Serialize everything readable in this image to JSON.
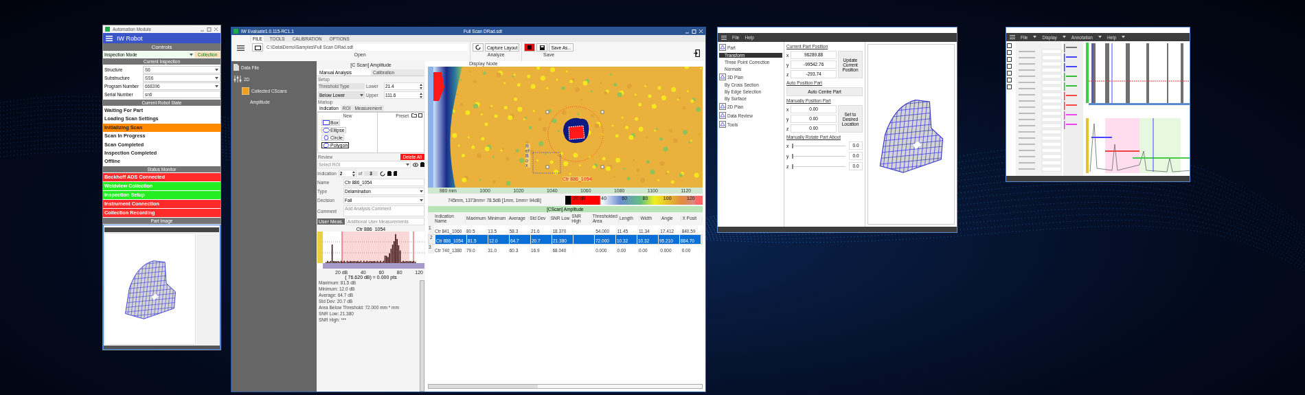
{
  "automation_window": {
    "title": "Automation Module",
    "app_title": "IW Robot",
    "controls_header": "Controls",
    "mode_label": "Inspection Mode",
    "mode_button": "Collection",
    "inspection_header": "Current Inspection",
    "fields": [
      {
        "label": "Structure",
        "value": "S6",
        "kind": "select"
      },
      {
        "label": "Substructure",
        "value": "SS6",
        "kind": "select"
      },
      {
        "label": "Program Number",
        "value": "668396",
        "kind": "select"
      },
      {
        "label": "Serial Number",
        "value": "sn6",
        "kind": "text"
      }
    ],
    "state_header": "Current Robot State",
    "states": [
      {
        "label": "Waiting For Part",
        "selected": false
      },
      {
        "label": "Loading Scan Settings",
        "selected": false
      },
      {
        "label": "Initializing Scan",
        "selected": true
      },
      {
        "label": "Scan In Progress",
        "selected": false
      },
      {
        "label": "Scan Completed",
        "selected": false
      },
      {
        "label": "Inspection Completed",
        "selected": false
      },
      {
        "label": "Offline",
        "selected": false
      }
    ],
    "status_header": "Status Monitor",
    "statuses": [
      {
        "label": "Beckhoff ADS Connected",
        "color": "#ff2a2a"
      },
      {
        "label": "Weldview Collection",
        "color": "#22ee22"
      },
      {
        "label": "Inspection Setup",
        "color": "#22ee22"
      },
      {
        "label": "Instrument Connection",
        "color": "#ff2a2a"
      },
      {
        "label": "Collection Recording",
        "color": "#ff2a2a"
      }
    ],
    "image_header": "Part Image"
  },
  "evaluate_window": {
    "title": "IW Evaluate1.0.115-RC1.1",
    "document": "Full Scan DRad.sdt",
    "menus": [
      {
        "label": "FILE",
        "selected": true
      },
      {
        "label": "TOOLS",
        "selected": false
      },
      {
        "label": "CALIBRATION",
        "selected": false
      },
      {
        "label": "OPTIONS",
        "selected": false
      }
    ],
    "path": "C:\\Data\\Demo\\Samples\\Full Scan DRad.sdt",
    "open_label": "Open",
    "capture_button": "Capture Layout",
    "save_as_button": "Save As...",
    "analyze_label": "Analyze",
    "save_label": "Save",
    "display_node_label": "Display Node",
    "tree": [
      {
        "label": "Data File",
        "kind": "file"
      },
      {
        "label": "2D",
        "kind": "group",
        "children": [
          {
            "label": "Collected CScans",
            "kind": "folder",
            "children": [
              {
                "label": "Amplitude"
              }
            ]
          }
        ]
      }
    ],
    "panel": {
      "title": "[C Scan] Amplitude",
      "tabs": [
        {
          "label": "Manual Analysis",
          "selected": true
        },
        {
          "label": "Calibration",
          "selected": false
        }
      ],
      "setup_label": "Setup",
      "threshold_label": "Threshold Type",
      "threshold_value": "Below Lower",
      "lower_label": "Lower",
      "lower_value": "21.4",
      "upper_label": "Upper",
      "upper_value": "111.6",
      "markup_label": "Markup",
      "markup_tabs": [
        {
          "label": "Indication",
          "selected": true
        },
        {
          "label": "ROI",
          "selected": false
        },
        {
          "label": "Measurement",
          "selected": false
        }
      ],
      "new_label": "New",
      "preset_label": "Preset",
      "shapes": [
        {
          "label": "Box",
          "kind": "box",
          "selected": false
        },
        {
          "label": "Ellipse",
          "kind": "ellipse",
          "selected": false
        },
        {
          "label": "Circle",
          "kind": "circle",
          "selected": false
        },
        {
          "label": "Polygon",
          "kind": "polygon",
          "selected": true
        }
      ],
      "review_label": "Review",
      "delete_button": "Delete All",
      "roi_placeholder": "Select ROI",
      "indication_label": "Indication",
      "indication_value": "2",
      "of_label": "of",
      "indication_total": "3",
      "fields": [
        {
          "label": "Name",
          "value": "Ctr 886_1054",
          "kind": "text"
        },
        {
          "label": "Type",
          "value": "Delamination",
          "kind": "select"
        },
        {
          "label": "Decision",
          "value": "Fail",
          "kind": "select"
        },
        {
          "label": "Comment",
          "placeholder": "Add Analysis Comment",
          "kind": "area"
        }
      ],
      "user_meas_button": "User Meas.",
      "user_meas_placeholder": "Additional User Measurements",
      "histogram": {
        "title": "Ctr 886_1054",
        "axis_labels": [
          "20 dB",
          "40",
          "60",
          "80",
          "120"
        ],
        "readout": "( 76.620 dB) = 0.000 pts"
      },
      "stats": [
        "Maximum: 81.5 dB",
        "Minimum: 12.0 dB",
        "Average: 64.7 dB",
        "Std Dev: 20.7 dB",
        "Area Below Threshold: 72.000 mm * mm",
        "SNR Low: 21.380",
        "SNR High: ***"
      ]
    },
    "cscan": {
      "x_labels": [
        "980 mm",
        "1000",
        "1020",
        "1040",
        "1060",
        "1080",
        "1100",
        "1120"
      ],
      "indication_label": "Ctr 886_1054",
      "ref_label": "Ref Box"
    },
    "readout": "745mm, 1373mm= 78.5dB [1mm, 1mm= 94dB]",
    "colorbar_labels": [
      "20 dB",
      "40",
      "60",
      "80",
      "100",
      "120"
    ],
    "table": {
      "title": "[CScan] Amplitude",
      "columns": [
        "Indication Name",
        "Maximum",
        "Minimum",
        "Average",
        "Std Dev",
        "SNR Low",
        "SNR High",
        "Thresholded Area",
        "Length",
        "Width",
        "Angle",
        "X Posit"
      ],
      "rows": [
        {
          "number": "1",
          "selected": false,
          "cells": [
            "Ctr 841_1060",
            "80.5",
            "13.5",
            "58.3",
            "21.6",
            "18.370",
            null,
            "54.000",
            "11.45",
            "11.34",
            "17.412",
            "840.59"
          ]
        },
        {
          "number": "2",
          "selected": true,
          "cells": [
            "Ctr 886_1054",
            "81.5",
            "12.0",
            "64.7",
            "20.7",
            "21.380",
            null,
            "72.000",
            "10.32",
            "10.32",
            "95.210",
            "884.70"
          ]
        },
        {
          "number": "3",
          "selected": false,
          "cells": [
            "Ctr 740_1380",
            "79.0",
            "31.0",
            "60.3",
            "16.9",
            "68.040",
            null,
            "0.000",
            "0.00",
            "0.00",
            "0.000",
            "0.00"
          ]
        }
      ]
    }
  },
  "plan_window": {
    "menus": [
      "File",
      "Help"
    ],
    "tree": [
      {
        "label": "Part",
        "selected": false,
        "children": [
          {
            "label": "Transform",
            "selected": true
          },
          {
            "label": "Three Point Correction",
            "selected": false
          },
          {
            "label": "Normals",
            "selected": false
          }
        ]
      },
      {
        "label": "3D Plan",
        "selected": false,
        "children": [
          {
            "label": "By Cross Section",
            "selected": false
          },
          {
            "label": "By Edge Selection",
            "selected": false
          },
          {
            "label": "By Surface",
            "selected": false
          }
        ]
      },
      {
        "label": "2D Plan",
        "selected": false
      },
      {
        "label": "Data Review",
        "selected": false
      },
      {
        "label": "Tools",
        "selected": false
      }
    ],
    "position_header": "Current Part Position",
    "position": [
      {
        "axis": "x",
        "value": "96289.88"
      },
      {
        "axis": "y",
        "value": "-99542.76"
      },
      {
        "axis": "z",
        "value": "-293.74"
      }
    ],
    "update_button": "Update Current Position",
    "auto_header": "Auto Position Part",
    "auto_button": "Auto Centre Part",
    "manual_header": "Manually Position Part",
    "manual": [
      {
        "axis": "x",
        "value": "0.00"
      },
      {
        "axis": "y",
        "value": "0.00"
      },
      {
        "axis": "z",
        "value": "0.00"
      }
    ],
    "set_button": "Set to Desired Location",
    "rotate_header": "Manually Rotate Part About",
    "rotate": [
      {
        "axis": "x",
        "value": "0.0",
        "level": 0
      },
      {
        "axis": "y",
        "value": "0.0",
        "level": 0
      },
      {
        "axis": "z",
        "value": "0.0",
        "level": 0
      }
    ]
  },
  "scope_window": {
    "menus": [
      "File",
      "Display",
      "Annotation",
      "Help"
    ]
  }
}
